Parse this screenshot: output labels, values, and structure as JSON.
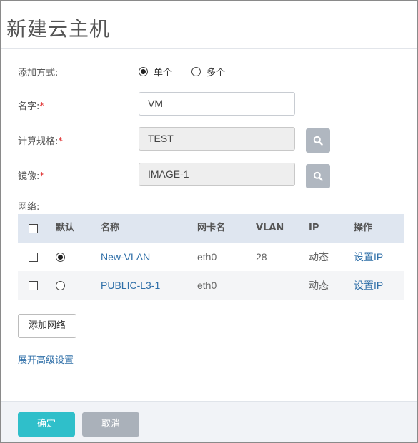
{
  "dialog": {
    "title": "新建云主机"
  },
  "form": {
    "add_mode": {
      "label": "添加方式:",
      "options": [
        {
          "label": "单个",
          "checked": true
        },
        {
          "label": "多个",
          "checked": false
        }
      ]
    },
    "name": {
      "label": "名字:",
      "required_mark": "*",
      "value": "VM"
    },
    "spec": {
      "label": "计算规格:",
      "required_mark": "*",
      "value": "TEST",
      "icon": "search-icon"
    },
    "image": {
      "label": "镜像:",
      "required_mark": "*",
      "value": "IMAGE-1",
      "icon": "search-icon"
    },
    "network_label": "网络:"
  },
  "network_table": {
    "headers": [
      "默认",
      "名称",
      "网卡名",
      "VLAN",
      "IP",
      "操作"
    ],
    "rows": [
      {
        "default": true,
        "name": "New-VLAN",
        "nic": "eth0",
        "vlan": "28",
        "ip": "动态",
        "action": "设置IP"
      },
      {
        "default": false,
        "name": "PUBLIC-L3-1",
        "nic": "eth0",
        "vlan": "",
        "ip": "动态",
        "action": "设置IP"
      }
    ]
  },
  "add_network_label": "添加网络",
  "advanced_label": "展开高级设置",
  "footer": {
    "ok_label": "确定",
    "cancel_label": "取消"
  },
  "colors": {
    "accent": "#2fbfca",
    "link": "#2f6fa8",
    "required": "#e03030",
    "header_row": "#dfe6f0"
  }
}
